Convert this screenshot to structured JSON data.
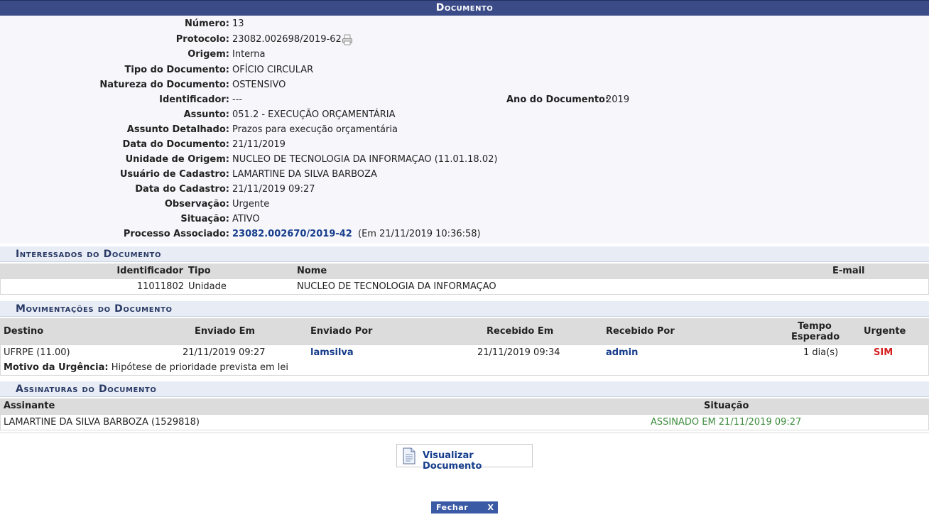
{
  "header": {
    "title": "Documento"
  },
  "details": {
    "numero": {
      "label": "Número:",
      "value": "13"
    },
    "protocolo": {
      "label": "Protocolo:",
      "value": "23082.002698/2019-62"
    },
    "origem": {
      "label": "Origem:",
      "value": "Interna"
    },
    "tipo": {
      "label": "Tipo do Documento:",
      "value": "OFÍCIO CIRCULAR"
    },
    "natureza": {
      "label": "Natureza do Documento:",
      "value": "OSTENSIVO"
    },
    "identificador": {
      "label": "Identificador:",
      "value": "---"
    },
    "ano": {
      "label": "Ano do Documento:",
      "value": "2019"
    },
    "assunto": {
      "label": "Assunto:",
      "value": "051.2 - EXECUÇÃO ORÇAMENTÁRIA"
    },
    "assunto_detalhado": {
      "label": "Assunto Detalhado:",
      "value": "Prazos para execução orçamentária"
    },
    "data_documento": {
      "label": "Data do Documento:",
      "value": "21/11/2019"
    },
    "unidade_origem": {
      "label": "Unidade de Origem:",
      "value": "NUCLEO DE TECNOLOGIA DA INFORMAÇAO (11.01.18.02)"
    },
    "usuario_cadastro": {
      "label": "Usuário de Cadastro:",
      "value": "LAMARTINE DA SILVA BARBOZA"
    },
    "data_cadastro": {
      "label": "Data do Cadastro:",
      "value": "21/11/2019 09:27"
    },
    "observacao": {
      "label": "Observação:",
      "value": "Urgente"
    },
    "situacao": {
      "label": "Situação:",
      "value": "ATIVO"
    },
    "processo": {
      "label": "Processo Associado:",
      "link": "23082.002670/2019-42",
      "suffix": "(Em 21/11/2019 10:36:58)"
    }
  },
  "interessados": {
    "title": "Interessados do Documento",
    "headers": {
      "identificador": "Identificador",
      "tipo": "Tipo",
      "nome": "Nome",
      "email": "E-mail"
    },
    "rows": [
      {
        "identificador": "11011802",
        "tipo": "Unidade",
        "nome": "NUCLEO DE TECNOLOGIA DA INFORMAÇAO",
        "email": ""
      }
    ]
  },
  "movimentacoes": {
    "title": "Movimentações do Documento",
    "headers": {
      "destino": "Destino",
      "enviado_em": "Enviado Em",
      "enviado_por": "Enviado Por",
      "recebido_em": "Recebido Em",
      "recebido_por": "Recebido Por",
      "tempo_1": "Tempo",
      "tempo_2": "Esperado",
      "urgente": "Urgente"
    },
    "rows": [
      {
        "destino": "UFRPE (11.00)",
        "enviado_em": "21/11/2019 09:27",
        "enviado_por": "lamsilva",
        "recebido_em": "21/11/2019 09:34",
        "recebido_por": "admin",
        "tempo": "1 dia(s)",
        "urgente": "SIM"
      }
    ],
    "motivo_label": "Motivo da Urgência:",
    "motivo_value": "Hipótese de prioridade prevista em lei"
  },
  "assinaturas": {
    "title": "Assinaturas do Documento",
    "headers": {
      "assinante": "Assinante",
      "situacao": "Situação"
    },
    "rows": [
      {
        "assinante": "LAMARTINE DA SILVA BARBOZA (1529818)",
        "situacao": "ASSINADO EM 21/11/2019 09:27"
      }
    ]
  },
  "actions": {
    "view_label": "Visualizar Documento",
    "close_label": "Fechar",
    "close_x": "X"
  },
  "icons": {
    "protocol": "print-icon",
    "view": "document-icon"
  },
  "colors": {
    "header_bg": "#3b4b87",
    "link": "#163d8c",
    "urgent": "#d42020",
    "signed": "#3c8c3c"
  }
}
